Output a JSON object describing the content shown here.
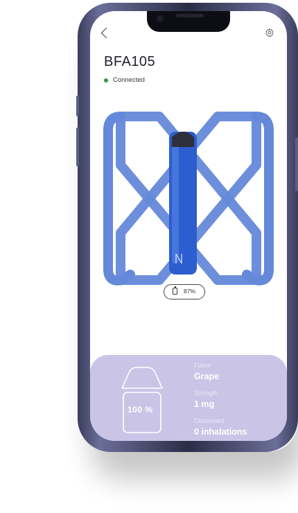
{
  "device": {
    "name": "BFA105",
    "status": "Connected",
    "battery_percent": "87%"
  },
  "pod": {
    "level": "100 %"
  },
  "info": {
    "flavor_label": "Flavor",
    "flavor_value": "Grape",
    "strength_label": "Strength",
    "strength_value": "1 mg",
    "consumed_label": "Consumed",
    "consumed_value": "0 inhalations"
  },
  "icons": {
    "back": "chevron-left-icon",
    "settings": "gear-icon",
    "battery": "battery-icon"
  },
  "colors": {
    "logo": "#5f86d8",
    "device_body": "#2f5fd0",
    "panel": "#cac5e6",
    "status": "#2e9d3a"
  }
}
